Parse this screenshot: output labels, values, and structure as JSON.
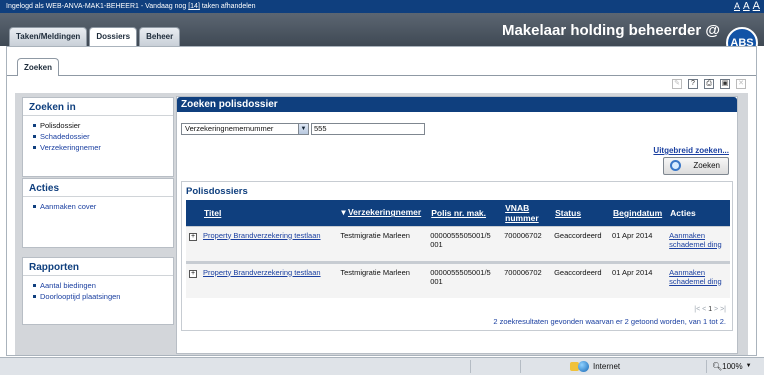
{
  "topbar": {
    "login_prefix": "Ingelogd als WEB-ANVA-MAK1-BEHEER1 - Vandaag nog ",
    "task_count": "[14]",
    "login_suffix": " taken afhandelen",
    "font_sizes": [
      "A",
      "A",
      "A"
    ]
  },
  "header": {
    "tabs": [
      {
        "label": "Taken/Meldingen",
        "active": false
      },
      {
        "label": "Dossiers",
        "active": true
      },
      {
        "label": "Beheer",
        "active": false
      }
    ],
    "brand": "Makelaar holding beheerder @",
    "logo": "ABS"
  },
  "subtab": "Zoeken",
  "toolbar_icons": [
    "edit-icon",
    "help-icon",
    "print-icon",
    "save-icon",
    "close-icon"
  ],
  "left": {
    "search_in": {
      "title": "Zoeken in",
      "items": [
        "Polisdossier",
        "Schadedossier",
        "Verzekeringnemer"
      ]
    },
    "actions": {
      "title": "Acties",
      "items": [
        "Aanmaken cover"
      ]
    },
    "reports": {
      "title": "Rapporten",
      "items": [
        "Aantal biedingen",
        "Doorlooptijd plaatsingen"
      ]
    }
  },
  "main": {
    "title": "Zoeken polisdossier",
    "select_value": "Verzekeringnemernummer",
    "input_value": "555",
    "advanced_link": "Uitgebreid zoeken...",
    "search_button": "Zoeken",
    "results_title": "Polisdossiers",
    "columns": [
      "Titel",
      "Verzekeringnemer",
      "Polis nr. mak.",
      "VNAB nummer",
      "Status",
      "Begindatum",
      "Acties"
    ],
    "rows": [
      {
        "titel": "Property Brandverzekering testlaan",
        "verzekeringnemer": "Testmigratie Marleen",
        "polis": "0000055505001/5 001",
        "vnab": "700006702",
        "status": "Geaccordeerd",
        "begindatum": "01 Apr 2014",
        "actie": "Aanmaken schademel ding"
      },
      {
        "titel": "Property Brandverzekering testlaan",
        "verzekeringnemer": "Testmigratie Marleen",
        "polis": "0000055505001/5 001",
        "vnab": "700006702",
        "status": "Geaccordeerd",
        "begindatum": "01 Apr 2014",
        "actie": "Aanmaken schademel ding"
      }
    ],
    "pager": {
      "first": "|<",
      "prev": "<",
      "current": "1",
      "next": ">",
      "last": ">|"
    },
    "summary": "2 zoekresultaten gevonden waarvan er 2 getoond worden, van 1 tot 2."
  },
  "statusbar": {
    "zone": "Internet",
    "zoom": "100%"
  },
  "colors": {
    "navy": "#0f3f7e",
    "link": "#1a3fa0",
    "gray_bg": "#d3d6da"
  }
}
